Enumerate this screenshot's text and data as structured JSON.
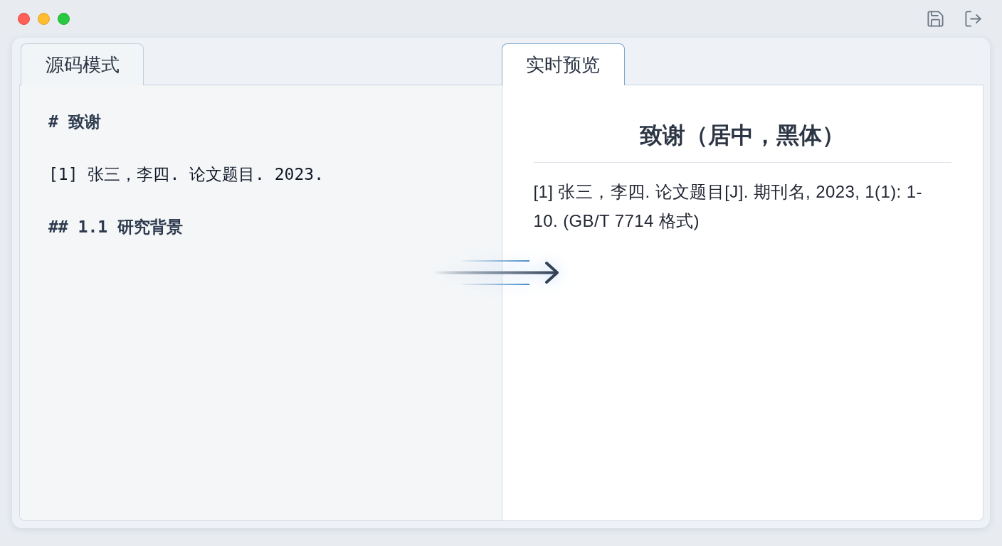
{
  "source_pane": {
    "tab": {
      "label": "源码模式",
      "selected": false
    },
    "lines": [
      {
        "kind": "heading",
        "text": "# 致谢"
      },
      {
        "kind": "text",
        "text": "[1] 张三，李四. 论文题目. 2023."
      },
      {
        "kind": "heading",
        "text": "## 1.1 研究背景"
      }
    ]
  },
  "preview_pane": {
    "tab": {
      "label": "实时预览",
      "selected": true
    },
    "title": "致谢（居中，黑体）",
    "paragraphs": [
      "[1] 张三，李四. 论文题目[J]. 期刊名, 2023, 1(1): 1-10. (GB/T 7714 格式)"
    ]
  }
}
